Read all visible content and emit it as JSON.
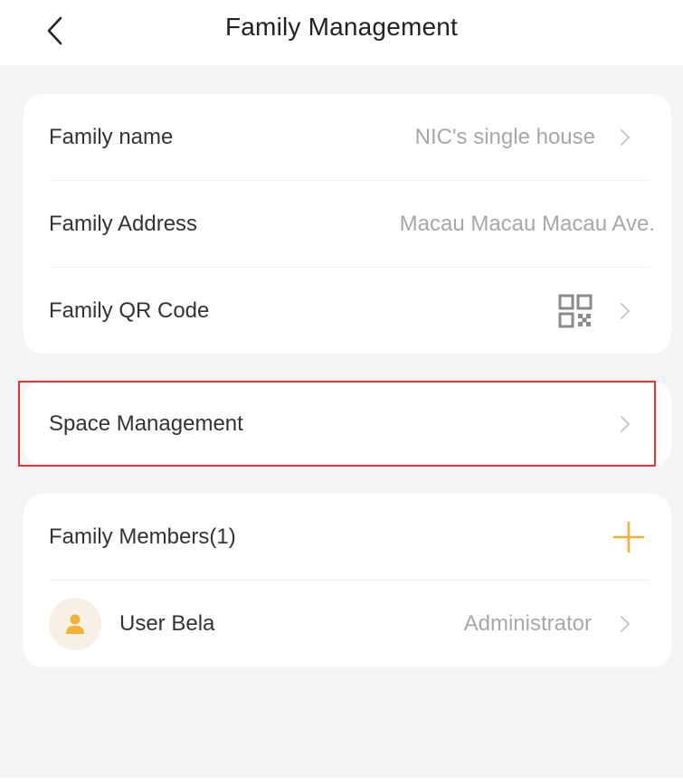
{
  "header": {
    "title": "Family Management",
    "back_icon": "chevron-left-icon"
  },
  "family_info": {
    "name_label": "Family name",
    "name_value": "NIC's single house",
    "address_label": "Family Address",
    "address_value": "Macau Macau Macau Ave.",
    "qr_label": "Family QR Code",
    "qr_icon": "qr-code-icon"
  },
  "space": {
    "label": "Space Management",
    "highlight_color": "#e5372f"
  },
  "members": {
    "title": "Family Members(1)",
    "add_icon": "plus-icon",
    "accent_color": "#f2b233",
    "list": [
      {
        "name": "User Bela",
        "role": "Administrator",
        "avatar_icon": "user-avatar-icon"
      }
    ]
  }
}
